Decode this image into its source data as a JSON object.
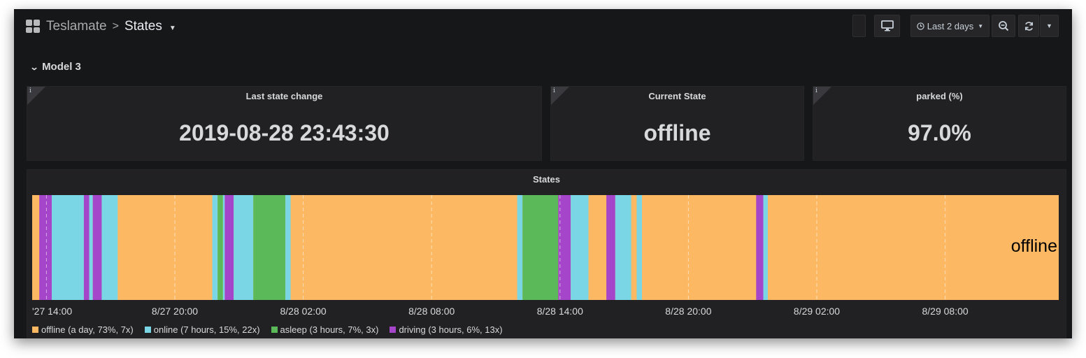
{
  "breadcrumb": {
    "parent": "Teslamate",
    "separator": ">",
    "title": "States"
  },
  "toolbar": {
    "tv_icon": "monitor-icon",
    "time_range_label": "Last 2 days",
    "clock_icon": "clock-icon",
    "zoom_icon": "zoom-out-icon",
    "refresh_icon": "refresh-icon",
    "dropdown_icon": "chevron-down-icon"
  },
  "row": {
    "title": "Model 3"
  },
  "panels": {
    "last_change": {
      "title": "Last state change",
      "value": "2019-08-28 23:43:30",
      "info": "i"
    },
    "current_state": {
      "title": "Current State",
      "value": "offline",
      "info": "i"
    },
    "parked": {
      "title": "parked (%)",
      "value": "97.0%",
      "info": "i"
    }
  },
  "states_panel": {
    "title": "States",
    "end_label": "offline",
    "x_ticks": [
      "'27 14:00",
      "8/27 20:00",
      "8/28 02:00",
      "8/28 08:00",
      "8/28 14:00",
      "8/28 20:00",
      "8/29 02:00",
      "8/29 08:00"
    ],
    "legend": [
      {
        "label": "offline (a day, 73%, 7x)",
        "color": "#fdb863"
      },
      {
        "label": "online (7 hours, 15%, 22x)",
        "color": "#7ad6e4"
      },
      {
        "label": "asleep (3 hours, 7%, 3x)",
        "color": "#5cb95a"
      },
      {
        "label": "driving (3 hours, 6%, 13x)",
        "color": "#a545c9"
      }
    ]
  },
  "chart_data": {
    "type": "table",
    "title": "States",
    "x_range": [
      "8/27 13:20",
      "8/29 13:20"
    ],
    "x_ticks": [
      "8/27 14:00",
      "8/27 20:00",
      "8/28 02:00",
      "8/28 08:00",
      "8/28 14:00",
      "8/28 20:00",
      "8/29 02:00",
      "8/29 08:00"
    ],
    "colors": {
      "offline": "#fdb863",
      "online": "#7ad6e4",
      "asleep": "#5cb95a",
      "driving": "#a545c9"
    },
    "segments": [
      {
        "state": "offline",
        "start": "8/27 13:20",
        "end": "8/27 13:40"
      },
      {
        "state": "driving",
        "start": "8/27 13:40",
        "end": "8/27 14:15"
      },
      {
        "state": "online",
        "start": "8/27 14:15",
        "end": "8/27 15:45"
      },
      {
        "state": "driving",
        "start": "8/27 15:45",
        "end": "8/27 16:00"
      },
      {
        "state": "online",
        "start": "8/27 16:00",
        "end": "8/27 16:10"
      },
      {
        "state": "driving",
        "start": "8/27 16:10",
        "end": "8/27 16:35"
      },
      {
        "state": "online",
        "start": "8/27 16:35",
        "end": "8/27 17:20"
      },
      {
        "state": "offline",
        "start": "8/27 17:20",
        "end": "8/27 21:45"
      },
      {
        "state": "online",
        "start": "8/27 21:45",
        "end": "8/27 22:00"
      },
      {
        "state": "asleep",
        "start": "8/27 22:00",
        "end": "8/27 22:15"
      },
      {
        "state": "online",
        "start": "8/27 22:15",
        "end": "8/27 22:20"
      },
      {
        "state": "driving",
        "start": "8/27 22:20",
        "end": "8/27 22:45"
      },
      {
        "state": "online",
        "start": "8/27 22:45",
        "end": "8/27 23:40"
      },
      {
        "state": "asleep",
        "start": "8/27 23:40",
        "end": "8/28 01:10"
      },
      {
        "state": "online",
        "start": "8/28 01:10",
        "end": "8/28 01:25"
      },
      {
        "state": "offline",
        "start": "8/28 01:25",
        "end": "8/28 12:00"
      },
      {
        "state": "online",
        "start": "8/28 12:00",
        "end": "8/28 12:15"
      },
      {
        "state": "asleep",
        "start": "8/28 12:15",
        "end": "8/28 13:55"
      },
      {
        "state": "driving",
        "start": "8/28 13:55",
        "end": "8/28 14:30"
      },
      {
        "state": "online",
        "start": "8/28 14:30",
        "end": "8/28 15:20"
      },
      {
        "state": "offline",
        "start": "8/28 15:20",
        "end": "8/28 16:10"
      },
      {
        "state": "driving",
        "start": "8/28 16:10",
        "end": "8/28 16:35"
      },
      {
        "state": "online",
        "start": "8/28 16:35",
        "end": "8/28 17:20"
      },
      {
        "state": "offline",
        "start": "8/28 17:20",
        "end": "8/28 17:35"
      },
      {
        "state": "online",
        "start": "8/28 17:35",
        "end": "8/28 17:50"
      },
      {
        "state": "offline",
        "start": "8/28 17:50",
        "end": "8/28 23:10"
      },
      {
        "state": "driving",
        "start": "8/28 23:10",
        "end": "8/28 23:30"
      },
      {
        "state": "online",
        "start": "8/28 23:30",
        "end": "8/28 23:43"
      },
      {
        "state": "offline",
        "start": "8/28 23:43",
        "end": "8/29 13:20"
      }
    ]
  }
}
